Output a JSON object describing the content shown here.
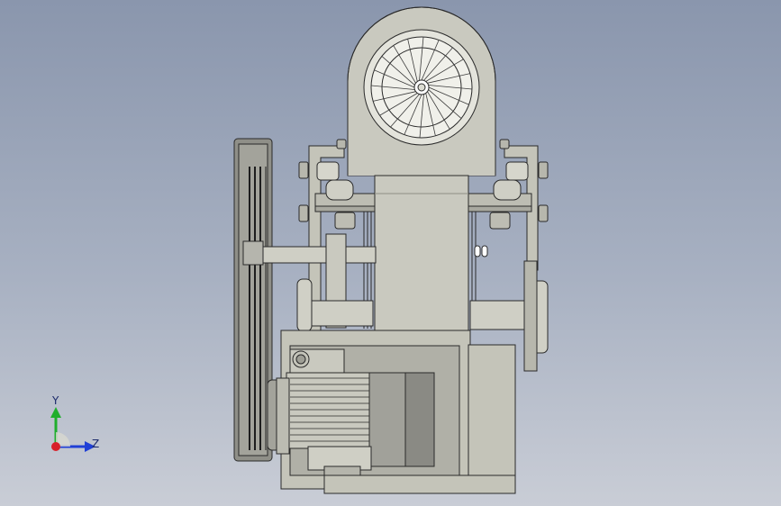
{
  "triad": {
    "y_label": "Y",
    "z_label": "Z",
    "colors": {
      "y": "#1fae2c",
      "z": "#1f3fd6",
      "x": "#d8202a"
    }
  },
  "colors": {
    "metal": "#c4c4b9",
    "metal_dark": "#9c9c92",
    "metal_light": "#dcdcd2",
    "outline": "#2a2a2a",
    "background_top": "#8a96ad",
    "background_bottom": "#c9cdd6"
  }
}
